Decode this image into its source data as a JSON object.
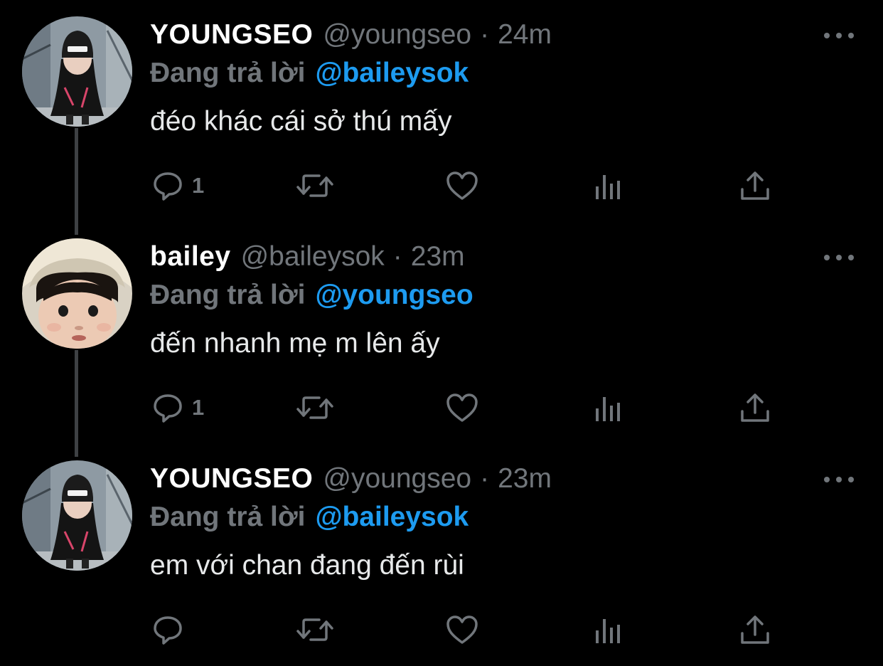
{
  "colors": {
    "background": "#000000",
    "text": "#e7e9ea",
    "muted": "#71767b",
    "link": "#1d9bf0",
    "thread_line": "#3e4144"
  },
  "icons": {
    "reply": "reply-icon",
    "retweet": "retweet-icon",
    "like": "heart-icon",
    "analytics": "analytics-icon",
    "share": "share-icon",
    "more": "more-icon"
  },
  "tweets": [
    {
      "name": "YOUNGSEO",
      "handle": "@youngseo",
      "separator": "·",
      "time": "24m",
      "reply_prefix": "Đang trả lời",
      "reply_to": "@baileysok",
      "text": "đéo khác cái sở thú mấy",
      "reply_count": "1"
    },
    {
      "name": "bailey",
      "handle": "@baileysok",
      "separator": "·",
      "time": "23m",
      "reply_prefix": "Đang trả lời",
      "reply_to": "@youngseo",
      "text": "đến nhanh mẹ m lên ấy",
      "reply_count": "1"
    },
    {
      "name": "YOUNGSEO",
      "handle": "@youngseo",
      "separator": "·",
      "time": "23m",
      "reply_prefix": "Đang trả lời",
      "reply_to": "@baileysok",
      "text": "em với chan đang đến rùi",
      "reply_count": ""
    }
  ]
}
